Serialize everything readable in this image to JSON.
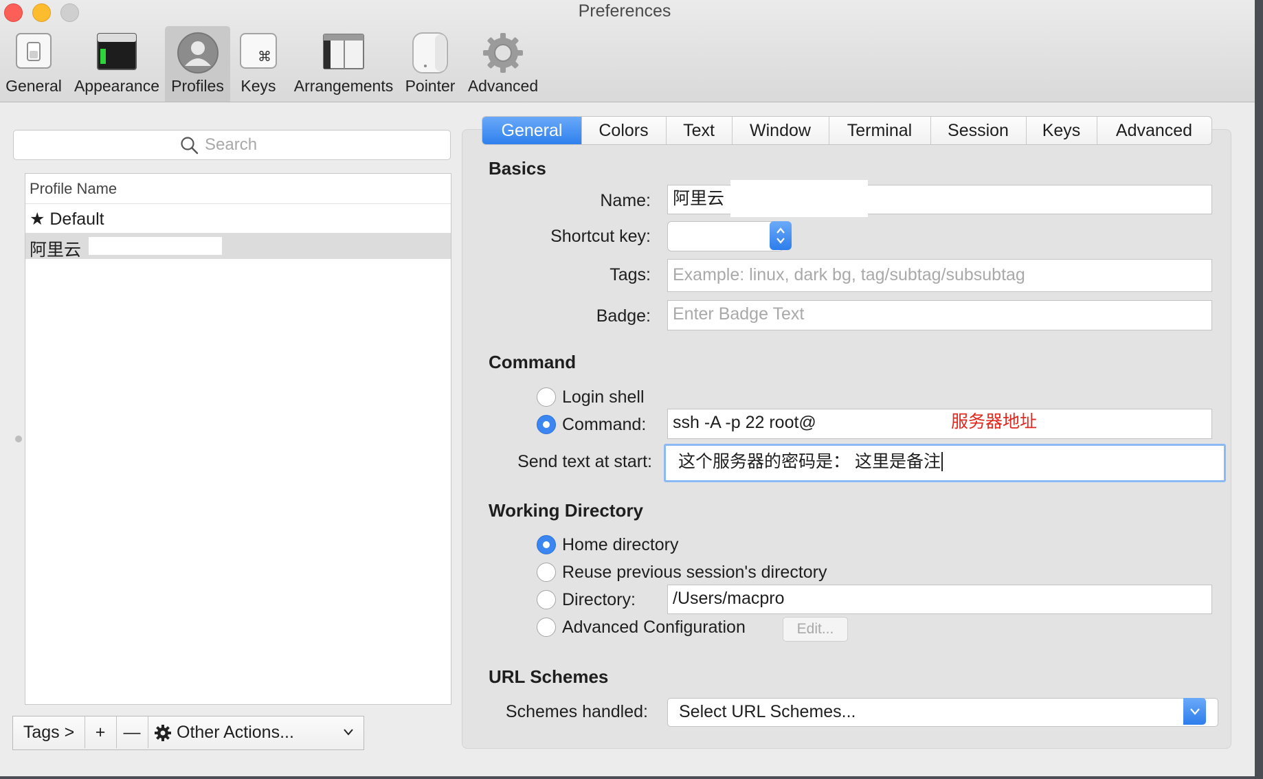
{
  "window": {
    "title": "Preferences"
  },
  "toolbar": {
    "items": [
      {
        "label": "General",
        "icon": "general-switch-icon"
      },
      {
        "label": "Appearance",
        "icon": "appearance-window-icon"
      },
      {
        "label": "Profiles",
        "icon": "profiles-user-icon",
        "selected": true
      },
      {
        "label": "Keys",
        "icon": "keys-command-icon"
      },
      {
        "label": "Arrangements",
        "icon": "arrangements-icon"
      },
      {
        "label": "Pointer",
        "icon": "pointer-mouse-icon"
      },
      {
        "label": "Advanced",
        "icon": "advanced-gear-icon"
      }
    ]
  },
  "sidebar": {
    "search_placeholder": "Search",
    "column_header": "Profile Name",
    "profiles": [
      {
        "label": "★ Default",
        "selected": false
      },
      {
        "label": "阿里云",
        "selected": true
      }
    ],
    "bottom": {
      "tags": "Tags >",
      "add": "+",
      "remove": "—",
      "other_actions": "Other Actions..."
    }
  },
  "tabs": [
    "General",
    "Colors",
    "Text",
    "Window",
    "Terminal",
    "Session",
    "Keys",
    "Advanced"
  ],
  "active_tab": "General",
  "basics": {
    "heading": "Basics",
    "name_label": "Name:",
    "name_value": "阿里云",
    "shortcut_label": "Shortcut key:",
    "tags_label": "Tags:",
    "tags_placeholder": "Example: linux, dark bg, tag/subtag/subsubtag",
    "badge_label": "Badge:",
    "badge_placeholder": "Enter Badge Text"
  },
  "command": {
    "heading": "Command",
    "login_shell": "Login shell",
    "command_label": "Command:",
    "command_value": "ssh -A -p 22 root@",
    "annotation": "服务器地址",
    "send_text_label": "Send text at start:",
    "send_text_value": "这个服务器的密码是： 这里是备注"
  },
  "working_directory": {
    "heading": "Working Directory",
    "home": "Home directory",
    "reuse": "Reuse previous session's directory",
    "directory_label": "Directory:",
    "directory_value": "/Users/macpro",
    "advanced": "Advanced Configuration",
    "edit_button": "Edit..."
  },
  "url_schemes": {
    "heading": "URL Schemes",
    "label": "Schemes handled:",
    "value": "Select URL Schemes..."
  },
  "colors": {
    "accent": "#3b86f1",
    "annotation": "#e0281e",
    "window_bg": "#ececec"
  }
}
